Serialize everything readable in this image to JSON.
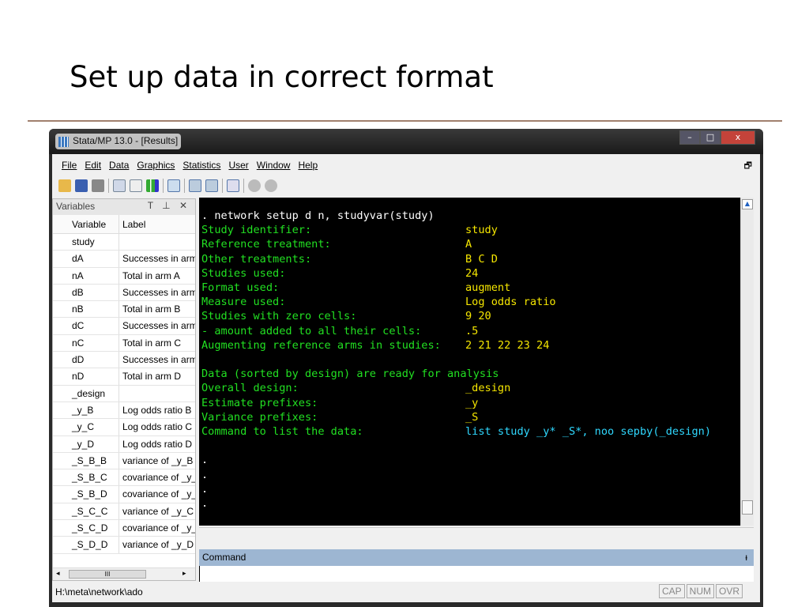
{
  "slide_title": "Set up data in correct format",
  "window": {
    "title": "Stata/MP 13.0 - [Results]",
    "min": "–",
    "max": "□",
    "close": "x"
  },
  "menu": [
    "File",
    "Edit",
    "Data",
    "Graphics",
    "Statistics",
    "User",
    "Window",
    "Help"
  ],
  "variables": {
    "title": "Variables",
    "controls": "T ⊥ ✕",
    "col_variable": "Variable",
    "col_label": "Label",
    "rows": [
      [
        "study",
        ""
      ],
      [
        "dA",
        "Successes in arm A"
      ],
      [
        "nA",
        "Total in arm A"
      ],
      [
        "dB",
        "Successes in arm B"
      ],
      [
        "nB",
        "Total in arm B"
      ],
      [
        "dC",
        "Successes in arm C"
      ],
      [
        "nC",
        "Total in arm C"
      ],
      [
        "dD",
        "Successes in arm D"
      ],
      [
        "nD",
        "Total in arm D"
      ],
      [
        "_design",
        ""
      ],
      [
        "_y_B",
        "Log odds ratio B"
      ],
      [
        "_y_C",
        "Log odds ratio C"
      ],
      [
        "_y_D",
        "Log odds ratio D"
      ],
      [
        "_S_B_B",
        "variance of _y_B"
      ],
      [
        "_S_B_C",
        "covariance of _y_B _y_C"
      ],
      [
        "_S_B_D",
        "covariance of _y_B _y_D"
      ],
      [
        "_S_C_C",
        "variance of _y_C"
      ],
      [
        "_S_C_D",
        "covariance of _y_C _y_D"
      ],
      [
        "_S_D_D",
        "variance of _y_D"
      ]
    ],
    "scroll_grip": "III"
  },
  "results": {
    "command": ". network setup d n, studyvar(study)",
    "lines": [
      [
        "Study identifier:",
        "study"
      ],
      [
        "Reference treatment:",
        "A"
      ],
      [
        "Other treatments:",
        "B C D"
      ],
      [
        "Studies used:",
        "24"
      ],
      [
        "Format used:",
        "augment"
      ],
      [
        "Measure used:",
        "Log odds ratio"
      ],
      [
        "Studies with zero cells:",
        "9 20"
      ],
      [
        "- amount added to all their cells:",
        ".5"
      ],
      [
        "Augmenting reference arms in studies:",
        "2 21 22 23 24"
      ]
    ],
    "ready": "Data (sorted by design) are ready for analysis",
    "lines2": [
      [
        "Overall design:",
        "_design"
      ],
      [
        "Estimate prefixes:",
        "_y"
      ],
      [
        "Variance prefixes:",
        "_S"
      ]
    ],
    "list_label": "Command to list the data:",
    "list_cmd": "list study _y* _S*, noo sepby(_design)",
    "dots": [
      ".",
      ".",
      ".",
      "."
    ]
  },
  "command": {
    "title": "Command",
    "pin": "ᵻ",
    "value": ""
  },
  "status": {
    "path": "H:\\meta\\network\\ado",
    "cap": "CAP",
    "num": "NUM",
    "ovr": "OVR"
  }
}
